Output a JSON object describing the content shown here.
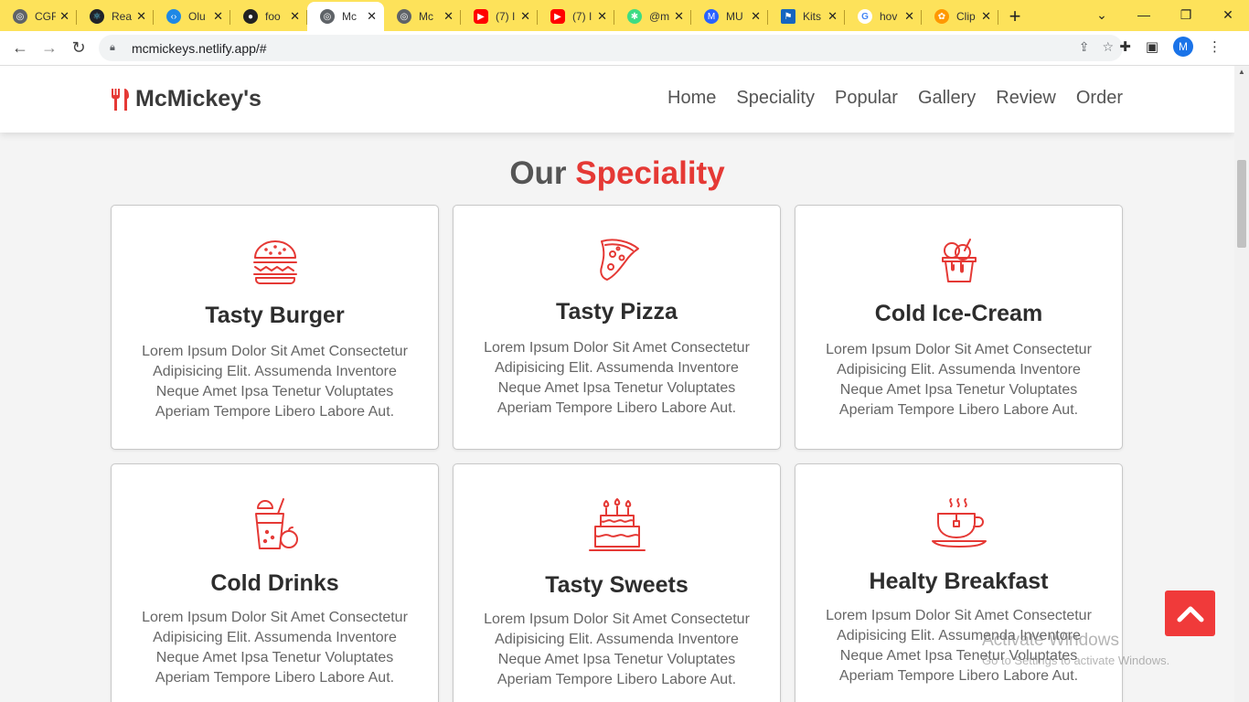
{
  "browser": {
    "tabs": [
      {
        "label": "CGF",
        "color": "#5f6368"
      },
      {
        "label": "Rea",
        "color": "#20232a"
      },
      {
        "label": "Olu",
        "color": "#1e88e5"
      },
      {
        "label": "foo",
        "color": "#222222"
      },
      {
        "label": "Mc",
        "color": "#5f6368"
      },
      {
        "label": "Mc",
        "color": "#5f6368"
      },
      {
        "label": "(7) I",
        "color": "#ff0000"
      },
      {
        "label": "(7) I",
        "color": "#ff0000"
      },
      {
        "label": "@m",
        "color": "#3ddc84"
      },
      {
        "label": "MU",
        "color": "#2962ff"
      },
      {
        "label": "Kits",
        "color": "#1565c0"
      },
      {
        "label": "hov",
        "color": "#4285f4"
      },
      {
        "label": "Clip",
        "color": "#ff9800"
      }
    ],
    "url": "mcmickeys.netlify.app/#",
    "profile_initial": "M"
  },
  "site": {
    "logo_text": "McMickey's",
    "nav": [
      "Home",
      "Speciality",
      "Popular",
      "Gallery",
      "Review",
      "Order"
    ],
    "heading_plain": "Our ",
    "heading_accent": "Speciality",
    "accent_color": "#e53935",
    "cards": [
      {
        "title": "Tasty Burger",
        "icon": "burger-icon",
        "text": "Lorem Ipsum Dolor Sit Amet Consectetur Adipisicing Elit. Assumenda Inventore Neque Amet Ipsa Tenetur Voluptates Aperiam Tempore Libero Labore Aut."
      },
      {
        "title": "Tasty Pizza",
        "icon": "pizza-icon",
        "text": "Lorem Ipsum Dolor Sit Amet Consectetur Adipisicing Elit. Assumenda Inventore Neque Amet Ipsa Tenetur Voluptates Aperiam Tempore Libero Labore Aut."
      },
      {
        "title": "Cold Ice-Cream",
        "icon": "ice-cream-icon",
        "text": "Lorem Ipsum Dolor Sit Amet Consectetur Adipisicing Elit. Assumenda Inventore Neque Amet Ipsa Tenetur Voluptates Aperiam Tempore Libero Labore Aut."
      },
      {
        "title": "Cold Drinks",
        "icon": "drink-icon",
        "text": "Lorem Ipsum Dolor Sit Amet Consectetur Adipisicing Elit. Assumenda Inventore Neque Amet Ipsa Tenetur Voluptates Aperiam Tempore Libero Labore Aut."
      },
      {
        "title": "Tasty Sweets",
        "icon": "cake-icon",
        "text": "Lorem Ipsum Dolor Sit Amet Consectetur Adipisicing Elit. Assumenda Inventore Neque Amet Ipsa Tenetur Voluptates Aperiam Tempore Libero Labore Aut."
      },
      {
        "title": "Healty Breakfast",
        "icon": "coffee-cup-icon",
        "text": "Lorem Ipsum Dolor Sit Amet Consectetur Adipisicing Elit. Assumenda Inventore Neque Amet Ipsa Tenetur Voluptates Aperiam Tempore Libero Labore Aut."
      }
    ]
  },
  "watermark": {
    "line1": "Activate Windows",
    "line2": "Go to Settings to activate Windows."
  }
}
